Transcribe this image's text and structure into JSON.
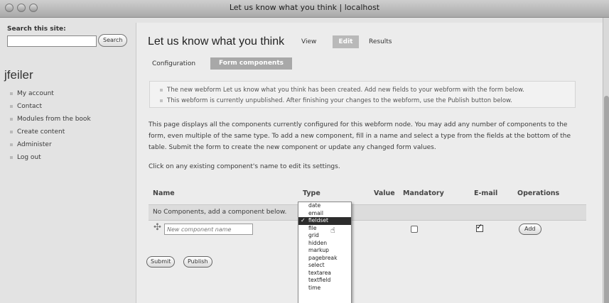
{
  "window": {
    "title": "Let us know what you think | localhost"
  },
  "sidebar": {
    "search_label": "Search this site:",
    "search_value": "",
    "search_button": "Search",
    "username": "jfeiler",
    "nav_items": [
      "My account",
      "Contact",
      "Modules from the book",
      "Create content",
      "Administer",
      "Log out"
    ]
  },
  "main": {
    "title": "Let us know what you think",
    "tabs": [
      {
        "label": "View",
        "active": false
      },
      {
        "label": "Edit",
        "active": true
      },
      {
        "label": "Results",
        "active": false
      }
    ],
    "subtabs": [
      {
        "label": "Configuration",
        "active": false
      },
      {
        "label": "Form components",
        "active": true
      }
    ],
    "messages": [
      "The new webform Let us know what you think has been created. Add new fields to your webform with the form below.",
      "This webform is currently unpublished. After finishing your changes to the webform, use the Publish button below."
    ],
    "description": "This page displays all the components currently configured for this webform node. You may add any number of components to the form, even multiple of the same type. To add a new component, fill in a name and select a type from the fields at the bottom of the table. Submit the form to create the new component or update any changed form values.",
    "hint": "Click on any existing component's name to edit its settings.",
    "table": {
      "headers": [
        "Name",
        "Type",
        "Value",
        "Mandatory",
        "E-mail",
        "Operations"
      ],
      "empty_text": "No Components, add a component below.",
      "new_name_placeholder": "New component name",
      "new_mandatory": false,
      "new_email": true,
      "add_button": "Add"
    },
    "submit_button": "Submit",
    "publish_button": "Publish"
  },
  "type_dropdown": {
    "selected": "fieldset",
    "options": [
      "date",
      "email",
      "fieldset",
      "file",
      "grid",
      "hidden",
      "markup",
      "pagebreak",
      "select",
      "textarea",
      "textfield",
      "time"
    ]
  }
}
